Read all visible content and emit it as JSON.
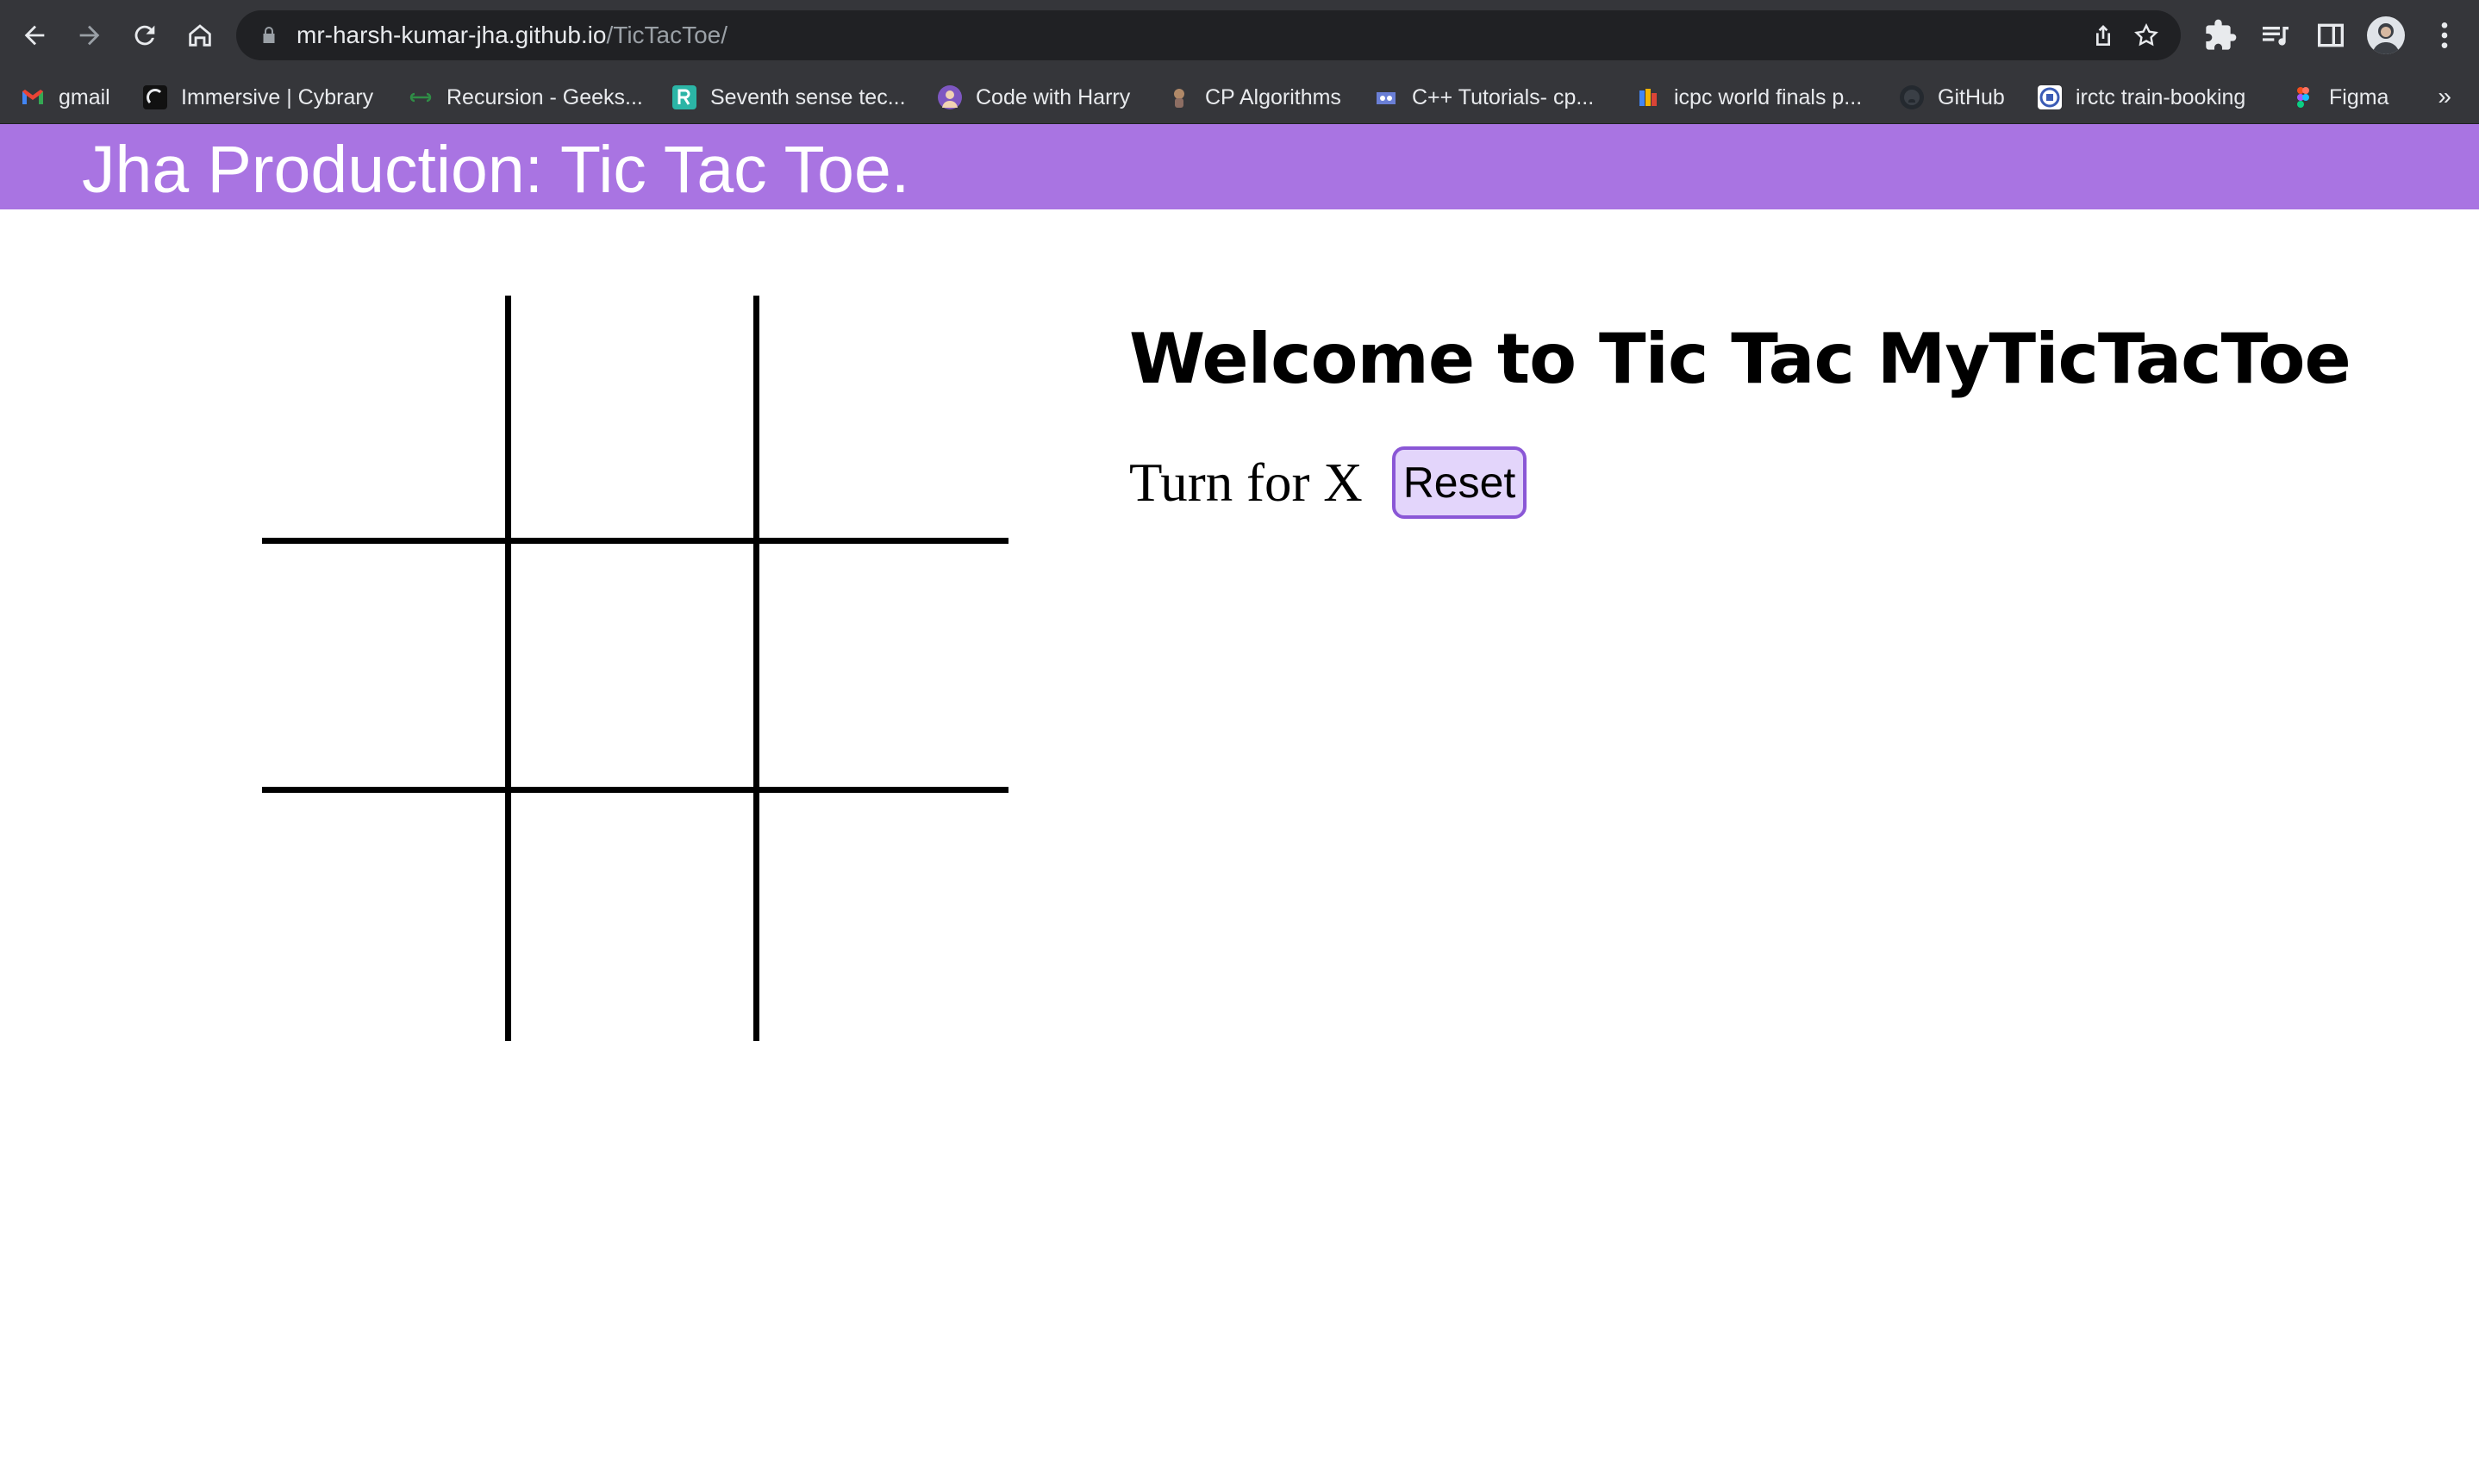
{
  "browser": {
    "url_host": "mr-harsh-kumar-jha.github.io",
    "url_path": "/TicTacToe/",
    "bookmarks": [
      {
        "label": "gmail",
        "icon": "gmail-icon",
        "color": "#ea4335"
      },
      {
        "label": "Immersive | Cybrary",
        "icon": "cybrary-icon",
        "color": "#111111"
      },
      {
        "label": "Recursion - Geeks...",
        "icon": "geeksforgeeks-icon",
        "color": "#2f8d46"
      },
      {
        "label": "Seventh sense tec...",
        "icon": "seventh-sense-icon",
        "color": "#2bb5a6"
      },
      {
        "label": "Code with Harry",
        "icon": "codewithharry-icon",
        "color": "#7e57c2"
      },
      {
        "label": "CP Algorithms",
        "icon": "cp-algorithms-icon",
        "color": "#b08968"
      },
      {
        "label": "C++ Tutorials- cp...",
        "icon": "cpp-icon",
        "color": "#6a7fd6"
      },
      {
        "label": "icpc world finals p...",
        "icon": "google-docs-icon",
        "color": "#f4b400"
      },
      {
        "label": "GitHub",
        "icon": "github-icon",
        "color": "#24292f"
      },
      {
        "label": "irctc train-booking",
        "icon": "irctc-icon",
        "color": "#3b5bb5"
      },
      {
        "label": "Figma",
        "icon": "figma-icon",
        "color": "#f24e1e"
      }
    ],
    "more_label": "»"
  },
  "site": {
    "title": "Jha Production: Tic Tac Toe.",
    "welcome": "Welcome to Tic Tac MyTicTacToe",
    "turn_text": "Turn for X",
    "reset_label": "Reset",
    "board": [
      "",
      "",
      "",
      "",
      "",
      "",
      "",
      "",
      ""
    ]
  }
}
